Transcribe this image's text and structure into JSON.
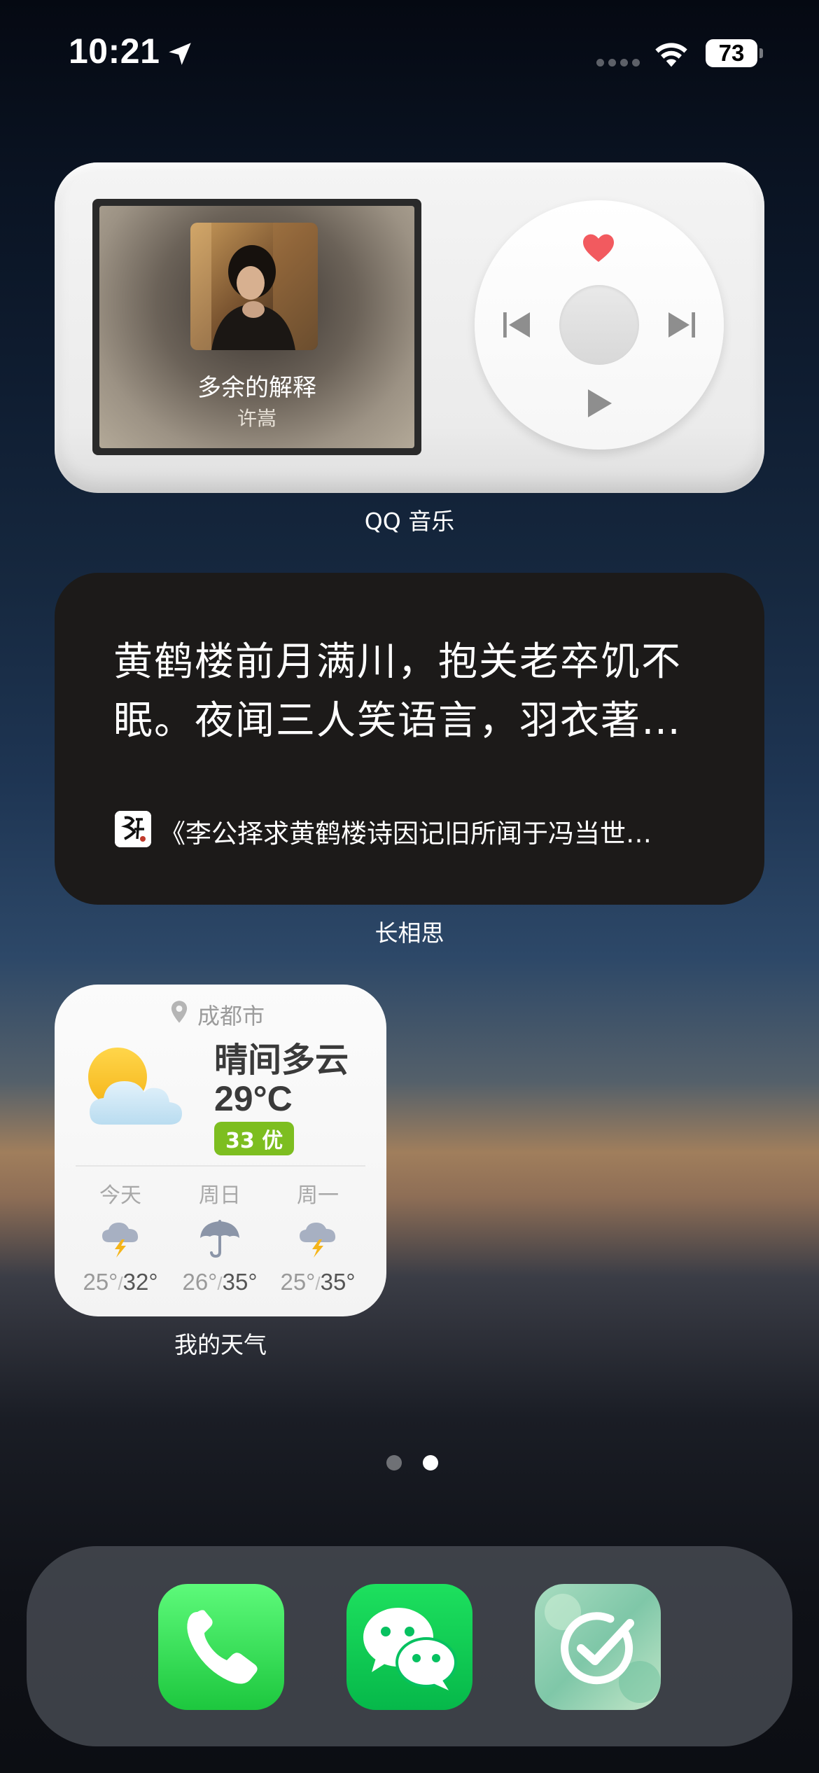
{
  "status_bar": {
    "time": "10:21",
    "battery": "73"
  },
  "music_widget": {
    "song_title": "多余的解释",
    "artist": "许嵩",
    "label": "QQ 音乐",
    "icons": [
      "heart-icon",
      "previous-icon",
      "next-icon",
      "play-icon"
    ]
  },
  "poem_widget": {
    "text": "黄鹤楼前月满川，抱关老卒饥不眠。夜闻三人笑语言，羽衣著…",
    "source": "《李公择求黄鹤楼诗因记旧所闻于冯当世…",
    "label": "长相思"
  },
  "weather_widget": {
    "city": "成都市",
    "condition": "晴间多云",
    "temperature": "29°C",
    "aqi": "33 优",
    "label": "我的天气",
    "forecast": [
      {
        "day": "今天",
        "low": "25°",
        "high": "32°",
        "icon": "thunderstorm-icon"
      },
      {
        "day": "周日",
        "low": "26°",
        "high": "35°",
        "icon": "umbrella-icon"
      },
      {
        "day": "周一",
        "low": "25°",
        "high": "35°",
        "icon": "thunderstorm-icon"
      }
    ],
    "colors": {
      "aqi_good": "#7dbe20"
    }
  },
  "page_indicator": {
    "total": 2,
    "current": 2
  },
  "dock": {
    "apps": [
      "phone-app",
      "wechat-app",
      "checklist-app"
    ],
    "colors": {
      "phone": "#34c759",
      "wechat": "#07c160"
    }
  }
}
